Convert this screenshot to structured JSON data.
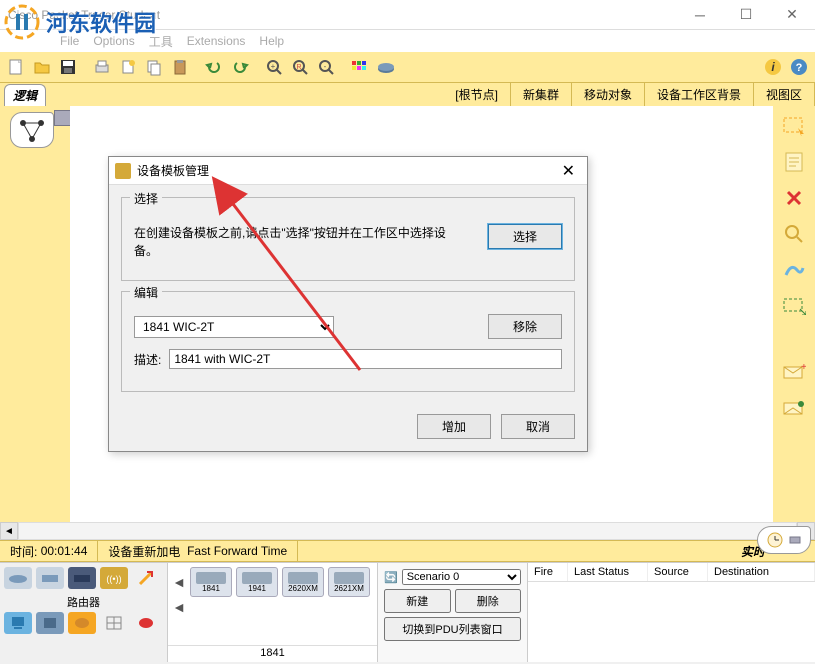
{
  "window": {
    "title": "Cisco Packet Tracer Student"
  },
  "watermark": "河东软件园",
  "menu": {
    "file": "File",
    "options": "Options",
    "view": "工具",
    "extensions": "Extensions",
    "help": "Help"
  },
  "tabs": {
    "logic": "逻辑",
    "root": "[根节点]",
    "new_cluster": "新集群",
    "move_object": "移动对象",
    "bg_workspace": "设备工作区背景",
    "viewport": "视图区"
  },
  "dialog": {
    "title": "设备模板管理",
    "select_group": "选择",
    "select_desc": "在创建设备模板之前,请点击\"选择\"按钮并在工作区中选择设备。",
    "select_btn": "选择",
    "edit_group": "编辑",
    "template_value": "1841 WIC-2T",
    "remove_btn": "移除",
    "desc_label": "描述:",
    "desc_value": "1841 with WIC-2T",
    "add_btn": "增加",
    "cancel_btn": "取消"
  },
  "timebar": {
    "time_label": "时间:",
    "time_value": "00:01:44",
    "power_label": "设备重新加电",
    "fast_forward": "Fast Forward Time",
    "realtime": "实时"
  },
  "devices": {
    "category_label": "路由器",
    "models": [
      "1841",
      "1941",
      "2620XM",
      "2621XM"
    ],
    "current_model": "1841"
  },
  "scenario": {
    "label": "Scenario 0",
    "new_btn": "新建",
    "delete_btn": "删除",
    "switch_btn": "切换到PDU列表窗口"
  },
  "sim_table": {
    "col_fire": "Fire",
    "col_last": "Last Status",
    "col_source": "Source",
    "col_dest": "Destination"
  }
}
